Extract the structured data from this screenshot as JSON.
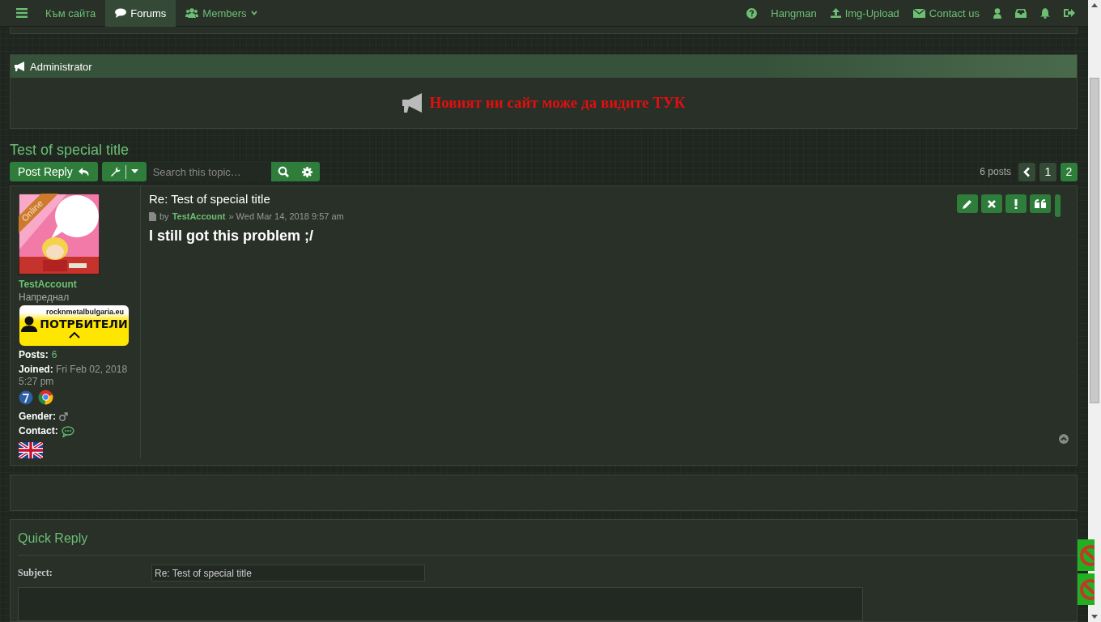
{
  "navbar": {
    "left": [
      {
        "label": "Към сайта",
        "selected": false
      },
      {
        "label": "Forums",
        "selected": true
      },
      {
        "label": "Members",
        "selected": false
      }
    ],
    "right": [
      "Hangman",
      "Img-Upload",
      "Contact us"
    ]
  },
  "announcement": {
    "title": "Administrator",
    "message": "Новият ни сайт може да видите ТУК"
  },
  "topic": {
    "title": "Test of special title",
    "post_reply": "Post Reply",
    "search": {
      "placeholder": "Search this topic…"
    },
    "post_count": "6 posts",
    "pages": [
      {
        "label": "1",
        "selected": false
      },
      {
        "label": "2",
        "selected": true
      }
    ]
  },
  "post": {
    "author": {
      "name": "TestAccount",
      "online": true,
      "status_label": "Online",
      "rank": "Напреднал",
      "rank_badge": {
        "site": "rocknmetalbulgaria.eu",
        "label": "ПОТРБИТЕЛИ"
      },
      "posts_label": "Posts:",
      "posts": "6",
      "joined_label": "Joined:",
      "joined": "Fri Feb 02, 2018 5:27 pm",
      "gender_label": "Gender:",
      "contact_label": "Contact:"
    },
    "subject": "Re: Test of special title",
    "by": "by",
    "author_link": "TestAccount",
    "date": "» Wed Mar 14, 2018 9:57 am",
    "body": "I still got this problem ;/"
  },
  "quick_reply": {
    "title": "Quick Reply",
    "subject_label": "Subject:",
    "subject_value": "Re: Test of special title"
  }
}
